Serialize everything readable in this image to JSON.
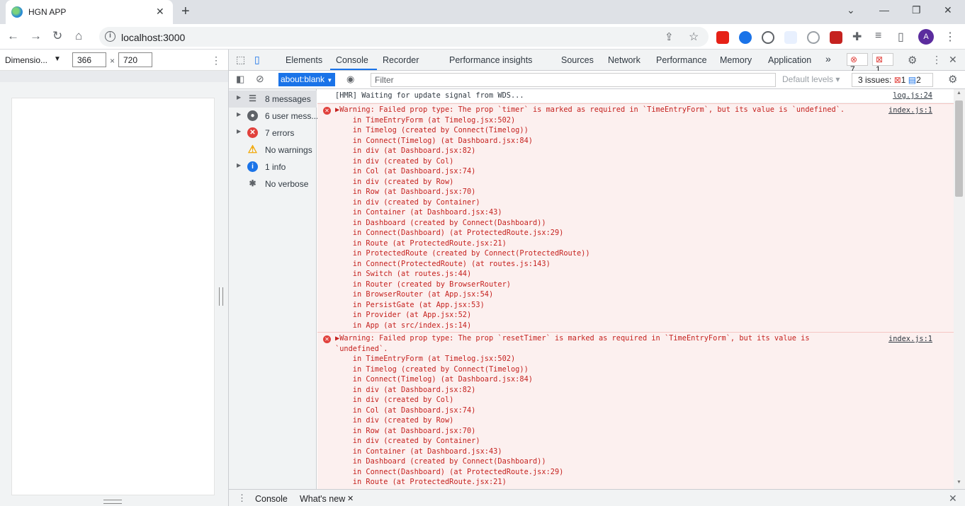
{
  "browser": {
    "tab_title": "HGN APP",
    "url": "localhost:3000"
  },
  "device_toolbar": {
    "dimensions_label": "Dimensio...",
    "width": "366",
    "height": "720",
    "times": "×"
  },
  "devtools": {
    "tabs": [
      "Elements",
      "Console",
      "Recorder",
      "Performance insights",
      "Sources",
      "Network",
      "Performance",
      "Memory",
      "Application"
    ],
    "more": "»",
    "error_count": "7",
    "issue_count": "1",
    "context": "about:blank",
    "filter_placeholder": "Filter",
    "levels": "Default levels",
    "issues_label": "3 issues:",
    "issues_red": "1",
    "issues_blue": "2"
  },
  "sidebar": {
    "items": [
      {
        "label": "8 messages",
        "icon": "list-icon"
      },
      {
        "label": "6 user mess...",
        "icon": "user-icon"
      },
      {
        "label": "7 errors",
        "icon": "error-icon"
      },
      {
        "label": "No warnings",
        "icon": "warning-icon"
      },
      {
        "label": "1 info",
        "icon": "info-icon"
      },
      {
        "label": "No verbose",
        "icon": "bug-icon"
      }
    ]
  },
  "console": {
    "hmr": {
      "text": "[HMR] Waiting for update signal from WDS...",
      "source": "log.js:24"
    },
    "errors": [
      {
        "source": "index.js:1",
        "lines": [
          "▶Warning: Failed prop type: The prop `timer` is marked as required in `TimeEntryForm`, but its value is `undefined`.",
          "    in TimeEntryForm (at Timelog.jsx:502)",
          "    in Timelog (created by Connect(Timelog))",
          "    in Connect(Timelog) (at Dashboard.jsx:84)",
          "    in div (at Dashboard.jsx:82)",
          "    in div (created by Col)",
          "    in Col (at Dashboard.jsx:74)",
          "    in div (created by Row)",
          "    in Row (at Dashboard.jsx:70)",
          "    in div (created by Container)",
          "    in Container (at Dashboard.jsx:43)",
          "    in Dashboard (created by Connect(Dashboard))",
          "    in Connect(Dashboard) (at ProtectedRoute.jsx:29)",
          "    in Route (at ProtectedRoute.jsx:21)",
          "    in ProtectedRoute (created by Connect(ProtectedRoute))",
          "    in Connect(ProtectedRoute) (at routes.js:143)",
          "    in Switch (at routes.js:44)",
          "    in Router (created by BrowserRouter)",
          "    in BrowserRouter (at App.jsx:54)",
          "    in PersistGate (at App.jsx:53)",
          "    in Provider (at App.jsx:52)",
          "    in App (at src/index.js:14)"
        ]
      },
      {
        "source": "index.js:1",
        "lines": [
          "▶Warning: Failed prop type: The prop `resetTimer` is marked as required in `TimeEntryForm`, but its value is",
          "`undefined`.",
          "    in TimeEntryForm (at Timelog.jsx:502)",
          "    in Timelog (created by Connect(Timelog))",
          "    in Connect(Timelog) (at Dashboard.jsx:84)",
          "    in div (at Dashboard.jsx:82)",
          "    in div (created by Col)",
          "    in Col (at Dashboard.jsx:74)",
          "    in div (created by Row)",
          "    in Row (at Dashboard.jsx:70)",
          "    in div (created by Container)",
          "    in Container (at Dashboard.jsx:43)",
          "    in Dashboard (created by Connect(Dashboard))",
          "    in Connect(Dashboard) (at ProtectedRoute.jsx:29)",
          "    in Route (at ProtectedRoute.jsx:21)"
        ]
      }
    ]
  },
  "drawer": {
    "tabs": [
      "Console",
      "What's new"
    ]
  },
  "colors": {
    "accent": "#1a73e8",
    "error": "#e1413c",
    "error_bg": "#fcf0ef"
  }
}
